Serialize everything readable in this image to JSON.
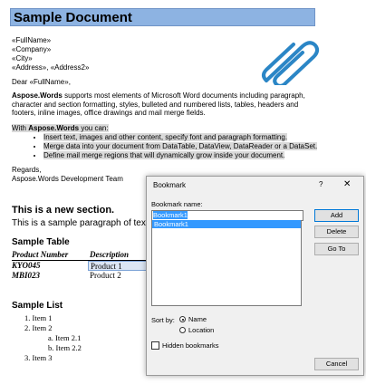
{
  "document": {
    "title": "Sample Document",
    "fields": [
      "«FullName»",
      "«Company»",
      "«City»",
      "«Address», «Address2»"
    ],
    "greeting": "Dear «FullName»,",
    "intro_bold": "Aspose.Words",
    "intro_rest": " supports most elements of Microsoft Word documents including paragraph, character and section formatting, styles, bulleted and numbered lists, tables, headers and footers, inline images, office drawings and mail merge fields.",
    "with_prefix": "With ",
    "with_bold": "Aspose.Words",
    "with_suffix": " you can:",
    "bullets": [
      "Insert text, images and other content, specify font and paragraph formatting.",
      "Merge data into your document from DataTable, DataView, DataReader or a DataSet.",
      "Define mail merge regions that will dynamically grow inside your document."
    ],
    "regards": "Regards,",
    "team": "Aspose.Words Development Team",
    "new_section": "This is a new section.",
    "sample_para": "This is a sample paragraph of text",
    "table_title": "Sample Table",
    "table": {
      "headers": [
        "Product Number",
        "Description"
      ],
      "rows": [
        [
          "KYO045",
          "Product 1"
        ],
        [
          "MBI023",
          "Product 2"
        ]
      ]
    },
    "list_title": "Sample List",
    "list": {
      "item1": "1.   Item 1",
      "item2": "2.   Item 2",
      "item21": "a.   Item 2.1",
      "item22": "b.   Item 2.2",
      "item3": "3.   Item 3"
    }
  },
  "dialog": {
    "title": "Bookmark",
    "help": "?",
    "close": "✕",
    "name_label": "Bookmark name:",
    "name_value": "Bookmark1",
    "list_items": [
      "Bookmark1"
    ],
    "buttons": {
      "add": "Add",
      "delete": "Delete",
      "goto": "Go To",
      "cancel": "Cancel"
    },
    "sort_by_label": "Sort by:",
    "sort_options": [
      "Name",
      "Location"
    ],
    "hidden_label": "Hidden bookmarks"
  },
  "colors": {
    "title_fill": "#8db3e2",
    "selection": "#3399ff",
    "clip": "#2b86c6"
  },
  "icons": {
    "clip": "paperclip-icon",
    "close": "close-icon"
  }
}
